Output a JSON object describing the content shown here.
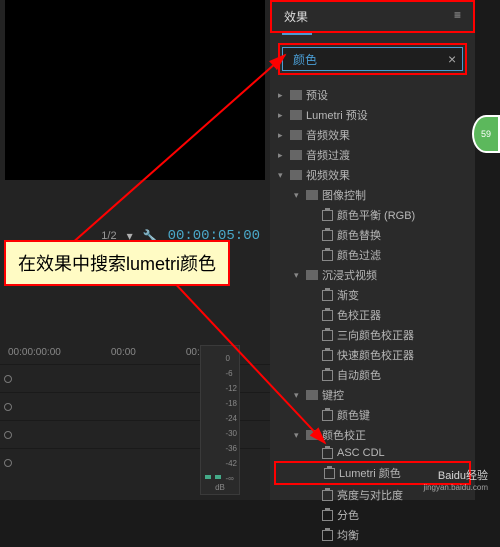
{
  "panel": {
    "tab_label": "效果",
    "search_value": "颜色",
    "search_placeholder": ""
  },
  "tree": {
    "items": [
      {
        "label": "预设",
        "icon": "folder",
        "chevron": "right",
        "indent": 0
      },
      {
        "label": "Lumetri 预设",
        "icon": "folder",
        "chevron": "right",
        "indent": 0
      },
      {
        "label": "音频效果",
        "icon": "folder",
        "chevron": "right",
        "indent": 0
      },
      {
        "label": "音频过渡",
        "icon": "folder",
        "chevron": "right",
        "indent": 0
      },
      {
        "label": "视频效果",
        "icon": "folder",
        "chevron": "down",
        "indent": 0
      },
      {
        "label": "图像控制",
        "icon": "folder",
        "chevron": "down",
        "indent": 1
      },
      {
        "label": "颜色平衡 (RGB)",
        "icon": "preset",
        "indent": 2
      },
      {
        "label": "颜色替换",
        "icon": "preset",
        "indent": 2
      },
      {
        "label": "颜色过滤",
        "icon": "preset",
        "indent": 2
      },
      {
        "label": "沉浸式视频",
        "icon": "folder",
        "chevron": "down",
        "indent": 1
      },
      {
        "label": "渐变",
        "icon": "preset",
        "indent": 2,
        "partial": true
      },
      {
        "label": "色校正器",
        "icon": "preset",
        "indent": 2,
        "partial": true
      },
      {
        "label": "三向颜色校正器",
        "icon": "preset",
        "indent": 2
      },
      {
        "label": "快速颜色校正器",
        "icon": "preset",
        "indent": 2
      },
      {
        "label": "自动颜色",
        "icon": "preset",
        "indent": 2
      },
      {
        "label": "键控",
        "icon": "folder",
        "chevron": "down",
        "indent": 1
      },
      {
        "label": "颜色键",
        "icon": "preset",
        "indent": 2
      },
      {
        "label": "颜色校正",
        "icon": "folder",
        "chevron": "down",
        "indent": 1
      },
      {
        "label": "ASC CDL",
        "icon": "preset",
        "indent": 2
      },
      {
        "label": "Lumetri 颜色",
        "icon": "preset",
        "indent": 2,
        "highlight": true
      },
      {
        "label": "亮度与对比度",
        "icon": "preset",
        "indent": 2,
        "partial": true
      },
      {
        "label": "分色",
        "icon": "preset",
        "indent": 2
      },
      {
        "label": "均衡",
        "icon": "preset",
        "indent": 2
      }
    ]
  },
  "timecode": {
    "ratio": "1/2",
    "time": "00:00:05:00"
  },
  "timeline": {
    "labels": [
      "00:00:00:00",
      "00:00",
      "00:0"
    ]
  },
  "meter": {
    "ticks": [
      "0",
      "-6",
      "-12",
      "-18",
      "-24",
      "-30",
      "-36",
      "-42",
      "-∞"
    ],
    "unit": "dB"
  },
  "callout": {
    "text": "在效果中搜索lumetri颜色"
  },
  "badge": {
    "text": "59"
  },
  "watermark": {
    "brand": "Baidu经验",
    "url": "jingyan.baidu.com"
  }
}
